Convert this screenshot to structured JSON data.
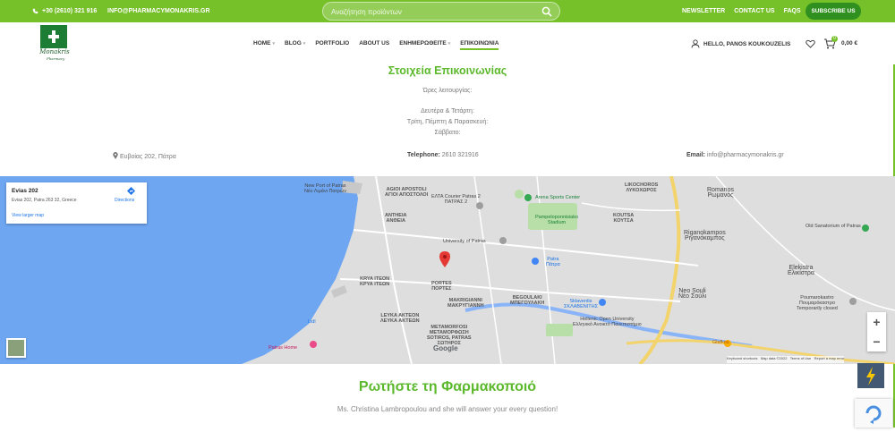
{
  "topbar": {
    "phone": "+30 (2610) 321 916",
    "email": "INFO@PHARMACYMONAKRIS.GR",
    "search_placeholder": "Αναζήτηση προϊόντων",
    "links": [
      "NEWSLETTER",
      "CONTACT US",
      "FAQS"
    ],
    "subscribe": "SUBSCRIBE US"
  },
  "header": {
    "logo_text": "Monakris",
    "logo_subtext": "Pharmacy",
    "nav": [
      "HOME",
      "BLOG",
      "PORTFOLIO",
      "ABOUT US",
      "ΕΝΗΜΕΡΩΘΕΙΤΕ",
      "ΕΠΙΚΟΙΝΩΝΙΑ"
    ],
    "user_greeting": "HELLO, PANOS KOUKOUZELIS",
    "cart_count": "0",
    "cart_total": "0,00 €"
  },
  "contact": {
    "title": "Στοιχεία Επικοινωνίας",
    "hours_label": "Ώρες λειτουργίας:",
    "hours_lines": [
      "Δευτέρα & Τετάρτη:",
      "Τρίτη, Πέμπτη & Παρασκευή:",
      "Σάββατο:"
    ],
    "address": "Ευβοίας 202, Πάτρα",
    "phone_label": "Telephone:",
    "phone_value": "2610 321916",
    "email_label": "Email:",
    "email_value": "info@pharmacymonakris.gr"
  },
  "map": {
    "card_title": "Evias 202",
    "card_address": "Evias 202, Patra 263 32, Greece",
    "card_directions": "Directions",
    "card_larger": "View larger map",
    "labels": {
      "newport": "New Port of Patras",
      "newport_gr": "Νέο Λιμάνι Πατρών",
      "agioi": "AGIOI APOSTOLI",
      "agioi_gr": "ΑΓΙΟΙ ΑΠΟΣΤΟΛΟΙ",
      "elta": "ΕΛΤΑ Courier Patras 2",
      "elta_gr": "ΠΑΤΡΑΣ 2",
      "arena": "Arena Sports Center",
      "likochoros": "LIKOCHOROS",
      "likochoros_gr": "ΛΥΚΟΧΩΡΟΣ",
      "romanos": "Romanos",
      "romanos_gr": "Ρωμανός",
      "antheia": "ANTHEIA",
      "antheia_gr": "ΑΝΘΕΙΑ",
      "pamp": "Pampeloponnisiako",
      "pamp2": "Stadium",
      "koutsa": "KOUTSA",
      "koutsa_gr": "ΚΟΥΤΣΑ",
      "university": "University of Patras",
      "riganokampos": "Riganokampos",
      "riganokampos_gr": "Ριγανόκαμπος",
      "old_sanatorium": "Old Sanatorium of Patras",
      "patra": "Patra",
      "patra_gr": "Πάτρα",
      "elekistra": "Elekistra",
      "elekistra_gr": "Ελικίστρα",
      "kryaiteon": "KRYA ITEON",
      "kryaiteon_gr": "ΚΡΥΑ ΙΤΕΩΝ",
      "portes": "PORTES",
      "portes_gr": "ΠΟΡΤΕΣ",
      "makrigianni": "MAKRIGIANNI",
      "makrigianni_gr": "ΜΑΚΡΥΓΙΑΝΝΗ",
      "begoulaki": "BEGOULAKI",
      "begoulaki_gr": "ΜΠΕΓΟΥΛΑΚΗ",
      "skalaventis": "Sklaventis",
      "skalaventis_gr": "ΣΚΛΑΒΕΝΙΤΗΣ",
      "neosouli": "Neo Souli",
      "neosouli_gr": "Νέο Σούλι",
      "poumarokastro": "Poumarokastro",
      "poumarokastro_gr": "Πουμαρόκαστρο",
      "poumarokastro_note": "Temporarily closed",
      "leykaakteon": "LEYKA AKTEON",
      "leykaakteon_gr": "ΛΕΥΚΑ ΑΚΤΕΩΝ",
      "hellenic": "Hellenic Open University",
      "hellenic_gr": "Ελληνικό Ανοικτό Πανεπιστήμιο",
      "metamorfosi": "METAMORFOSI",
      "metamorfosi_gr": "ΜΕΤΑΜΟΡΦΩΣΗ",
      "sotiros": "SOTIROS, PATRAS",
      "sotiros_gr": "ΣΩΤΗΡΟΣ",
      "lidl": "Lidl",
      "patrashome": "Patras Home",
      "glafkos": "Glafkos",
      "google": "Google"
    },
    "attribution": [
      "Keyboard shortcuts",
      "Map data ©2022",
      "Terms of Use",
      "Report a map error"
    ]
  },
  "ask": {
    "title": "Ρωτήστε τη Φαρμακοποιό",
    "subtitle": "Ms. Christina Lambropoulou and she will answer your every question!"
  },
  "colors": {
    "brand_green": "#76c02a",
    "title_green": "#5cb82c",
    "dark_green": "#2f8f1f",
    "sea": "#6ea6f2",
    "map_land": "#dcdcdc"
  }
}
